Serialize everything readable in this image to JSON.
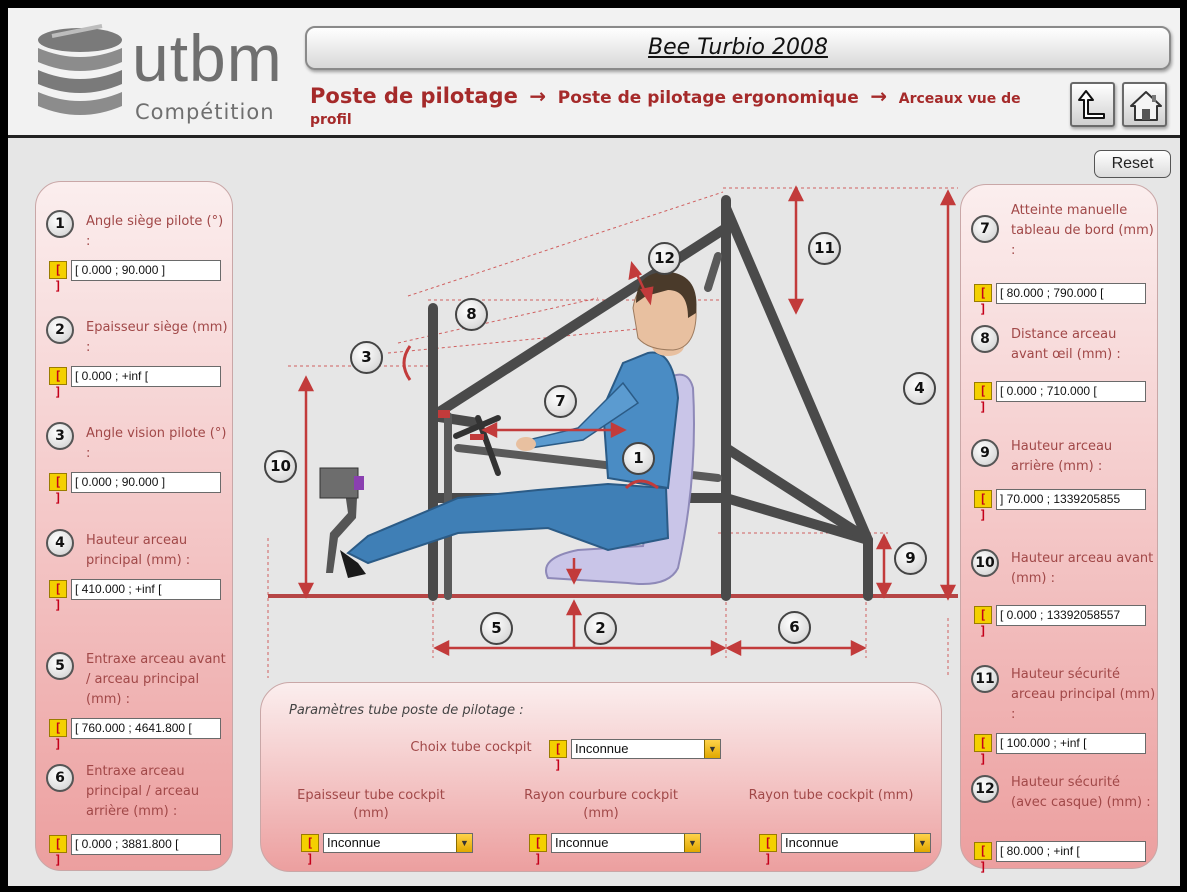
{
  "app": {
    "logo_word": "utbm",
    "logo_sub": "Compétition",
    "title": "Bee Turbio 2008",
    "breadcrumb": {
      "level1": "Poste de pilotage",
      "level2": "Poste de pilotage ergonomique",
      "level3": "Arceaux vue de profil",
      "separator": "→"
    },
    "reset_label": "Reset",
    "nav": {
      "back_icon": "back-arrow-icon",
      "home_icon": "home-icon"
    }
  },
  "colors": {
    "panel_pink": "#f3c3c3",
    "label_red": "#a14848",
    "breadcrumb_red": "#a52a2a",
    "bracket_yellow": "#f4d000",
    "dimension_red": "#c23b3b"
  },
  "left_params": [
    {
      "num": "1",
      "label": "Angle siège pilote (°) :",
      "range": "[ 0.000 ; 90.000 ]"
    },
    {
      "num": "2",
      "label": "Epaisseur siège (mm) :",
      "range": "[ 0.000 ; +inf ["
    },
    {
      "num": "3",
      "label": "Angle vision pilote (°) :",
      "range": "[ 0.000 ; 90.000 ]"
    },
    {
      "num": "4",
      "label": "Hauteur arceau principal (mm) :",
      "range": "[ 410.000 ; +inf ["
    },
    {
      "num": "5",
      "label": "Entraxe arceau avant / arceau principal (mm) :",
      "range": "[ 760.000 ; 4641.800 ["
    },
    {
      "num": "6",
      "label": "Entraxe arceau principal / arceau arrière (mm) :",
      "range": "[ 0.000 ; 3881.800 ["
    }
  ],
  "right_params": [
    {
      "num": "7",
      "label": "Atteinte manuelle tableau de bord (mm) :",
      "range": "[ 80.000 ; 790.000 ["
    },
    {
      "num": "8",
      "label": "Distance arceau avant œil (mm) :",
      "range": "[ 0.000 ; 710.000 ["
    },
    {
      "num": "9",
      "label": "Hauteur arceau arrière  (mm) :",
      "range": "] 70.000 ; 1339205855"
    },
    {
      "num": "10",
      "label": "Hauteur arceau avant (mm) :",
      "range": "[ 0.000 ; 13392058557"
    },
    {
      "num": "11",
      "label": "Hauteur sécurité arceau principal (mm) :",
      "range": "[ 100.000 ; +inf ["
    },
    {
      "num": "12",
      "label": "Hauteur sécurité (avec casque) (mm) :",
      "range": "[ 80.000 ; +inf ["
    }
  ],
  "bracket_label": "[ ]",
  "tube_params": {
    "title": "Paramètres tube poste de pilotage :",
    "choice_label": "Choix tube cockpit",
    "choice_value": "Inconnue",
    "thickness_label": "Epaisseur tube cockpit (mm)",
    "thickness_value": "Inconnue",
    "bend_label": "Rayon courbure cockpit (mm)",
    "bend_value": "Inconnue",
    "radius_label": "Rayon tube cockpit (mm)",
    "radius_value": "Inconnue"
  },
  "diagram": {
    "callouts": [
      "1",
      "2",
      "3",
      "4",
      "5",
      "6",
      "7",
      "8",
      "9",
      "10",
      "11",
      "12"
    ]
  }
}
